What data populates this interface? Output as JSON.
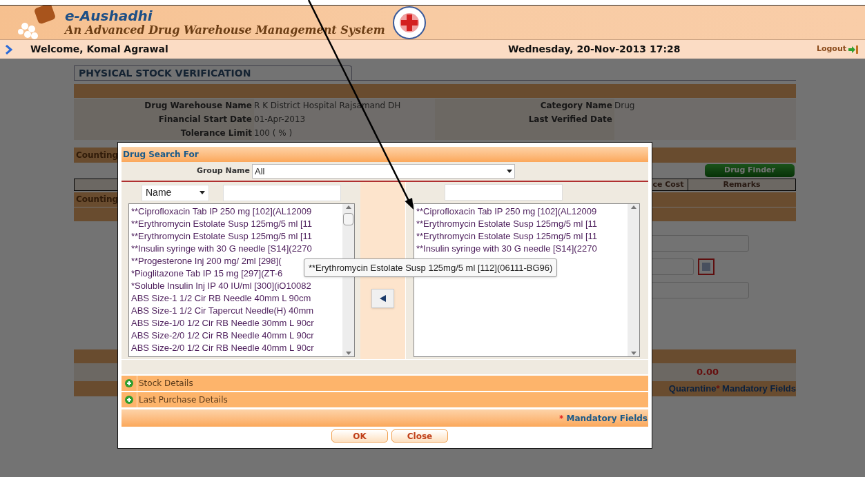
{
  "header": {
    "title": "e-Aushadhi",
    "subtitle": "An Advanced Drug Warehouse Management System",
    "welcome": "Welcome, Komal Agrawal",
    "datetime": "Wednesday, 20-Nov-2013 17:28",
    "logout": "Logout"
  },
  "page": {
    "tab": "PHYSICAL STOCK VERIFICATION",
    "rows": [
      {
        "label": "Drug Warehouse Name",
        "value": "R K District Hospital Rajsamand DH",
        "label_2": "Category Name",
        "value_2": "Drug"
      },
      {
        "label": "Financial Start Date",
        "value": "01-Apr-2013",
        "label_2": "Last Verified Date"
      },
      {
        "label": "Tolerance Limit",
        "value": "100 ( % )"
      }
    ],
    "counting_1": "Counting",
    "drug_finder": "Drug Finder",
    "columns": [
      "ce Cost",
      "Remarks"
    ],
    "counting_2": "Counting",
    "total": "0.00",
    "footer": {
      "left": "Quarantine",
      "star": "*",
      "right": "Mandatory Fields"
    }
  },
  "dialog": {
    "title": "Drug Search For",
    "group_label": "Group Name",
    "group_value": "All",
    "search_by": "Name",
    "left_items": [
      "**Ciprofloxacin Tab IP 250 mg [102](AL12009",
      "**Erythromycin Estolate Susp 125mg/5 ml [11",
      "**Erythromycin Estolate Susp 125mg/5 ml [11",
      "**Insulin syringe with 30 G needle [S14](2270",
      "**Progesterone Inj 200 mg/ 2ml [298](",
      "*Pioglitazone Tab IP 15 mg [297](ZT-6",
      "*Soluble Insulin Inj IP 40 IU/ml [300](iO10082",
      "ABS Size-1 1/2 Cir RB Needle 40mm L 90cm",
      "ABS Size-1 1/2 Cir Tapercut Needle(H) 40mm",
      "ABS Size-1/0 1/2 Cir RB Needle 30mm L 90cr",
      "ABS Size-2/0 1/2 Cir RB Needle 40mm L 90cr",
      "ABS Size-2/0 1/2 Cir RB Needle 40mm L 90cr"
    ],
    "right_items": [
      "**Ciprofloxacin Tab IP 250 mg [102](AL12009",
      "**Erythromycin Estolate Susp 125mg/5 ml [11",
      "**Erythromycin Estolate Susp 125mg/5 ml [11",
      "**Insulin syringe with 30 G needle [S14](2270"
    ],
    "tooltip": "**Erythromycin Estolate Susp 125mg/5 ml [112](06111-BG96)",
    "sections": [
      {
        "label": "Stock Details",
        "expanded": false
      },
      {
        "label": "Last Purchase Details",
        "expanded": false
      }
    ],
    "mandatory": {
      "star": "*",
      "text": "Mandatory Fields"
    },
    "buttons": [
      "OK",
      "Close"
    ]
  }
}
